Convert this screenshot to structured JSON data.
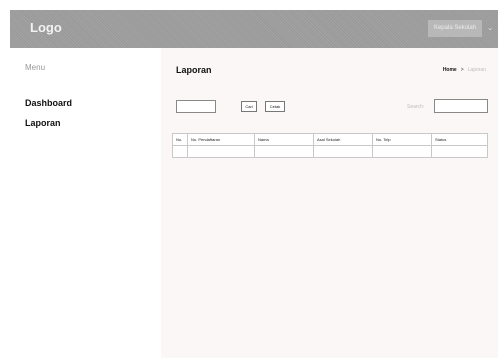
{
  "header": {
    "logo": "Logo",
    "user_label": "Kepala Sekolah",
    "caret": "⌄"
  },
  "sidebar": {
    "menu_title": "Menu",
    "items": [
      {
        "label": "Dashboard"
      },
      {
        "label": "Laporan"
      }
    ]
  },
  "main": {
    "title": "Laporan",
    "breadcrumb": {
      "home": "Home",
      "separator": ">",
      "current": "Laporan"
    },
    "filter": {
      "date_value": "",
      "cari_label": "Cari",
      "cetak_label": "Cetak"
    },
    "search": {
      "label": "Search:",
      "value": ""
    },
    "table": {
      "columns": [
        "No.",
        "No. Pendaftaran",
        "Nama",
        "Asal Sekolah",
        "No. Telp",
        "Status"
      ],
      "rows": []
    }
  }
}
